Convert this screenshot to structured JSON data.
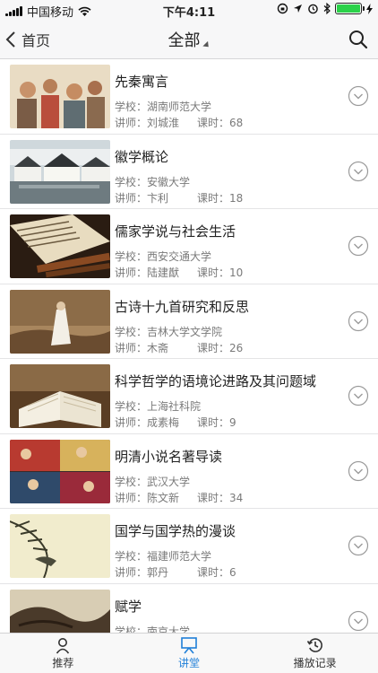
{
  "status": {
    "carrier": "中国移动",
    "time": "下午4:11"
  },
  "nav": {
    "back_label": "首页",
    "title": "全部"
  },
  "courses": [
    {
      "title": "先秦寓言",
      "school_label": "学校：",
      "school": "湖南师范大学",
      "teacher_label": "讲师：",
      "teacher": "刘城淮",
      "hours_label": "课时：",
      "hours": "68"
    },
    {
      "title": "徽学概论",
      "school_label": "学校：",
      "school": "安徽大学",
      "teacher_label": "讲师：",
      "teacher": "卞利",
      "hours_label": "课时：",
      "hours": "18"
    },
    {
      "title": "儒家学说与社会生活",
      "school_label": "学校：",
      "school": "西安交通大学",
      "teacher_label": "讲师：",
      "teacher": "陆建猷",
      "hours_label": "课时：",
      "hours": "10"
    },
    {
      "title": "古诗十九首研究和反思",
      "school_label": "学校：",
      "school": "吉林大学文学院",
      "teacher_label": "讲师：",
      "teacher": "木斋",
      "hours_label": "课时：",
      "hours": "26"
    },
    {
      "title": "科学哲学的语境论进路及其问题域",
      "school_label": "学校：",
      "school": "上海社科院",
      "teacher_label": "讲师：",
      "teacher": "成素梅",
      "hours_label": "课时：",
      "hours": "9"
    },
    {
      "title": "明清小说名著导读",
      "school_label": "学校：",
      "school": "武汉大学",
      "teacher_label": "讲师：",
      "teacher": "陈文新",
      "hours_label": "课时：",
      "hours": "34"
    },
    {
      "title": "国学与国学热的漫谈",
      "school_label": "学校：",
      "school": "福建师范大学",
      "teacher_label": "讲师：",
      "teacher": "郭丹",
      "hours_label": "课时：",
      "hours": "6"
    },
    {
      "title": "赋学",
      "school_label": "学校：",
      "school": "南京大学",
      "teacher_label": "",
      "teacher": "",
      "hours_label": "",
      "hours": ""
    }
  ],
  "tabs": [
    {
      "label": "推荐",
      "icon": "user-icon"
    },
    {
      "label": "讲堂",
      "icon": "lecture-hall-icon"
    },
    {
      "label": "播放记录",
      "icon": "history-icon"
    }
  ],
  "colors": {
    "accent": "#1f7fd8",
    "battery": "#2bd24a"
  }
}
